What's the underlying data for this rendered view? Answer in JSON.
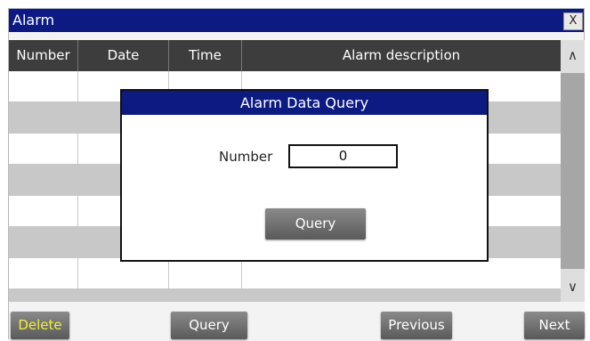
{
  "window": {
    "title": "Alarm",
    "close_label": "X"
  },
  "table": {
    "columns": [
      "Number",
      "Date",
      "Time",
      "Alarm description"
    ],
    "row_count": 8
  },
  "scrollbar": {
    "up_icon": "chevron-up-icon",
    "down_icon": "chevron-down-icon"
  },
  "footer": {
    "delete_label": "Delete",
    "query_label": "Query",
    "previous_label": "Previous",
    "next_label": "Next"
  },
  "dialog": {
    "title": "Alarm Data Query",
    "number_label": "Number",
    "number_value": "0",
    "query_label": "Query"
  },
  "colors": {
    "title_bar": "#0c1a82",
    "header_bg": "#3d3d3d",
    "row_alt": "#c8c8c8",
    "delete_text": "#f0f03c"
  }
}
